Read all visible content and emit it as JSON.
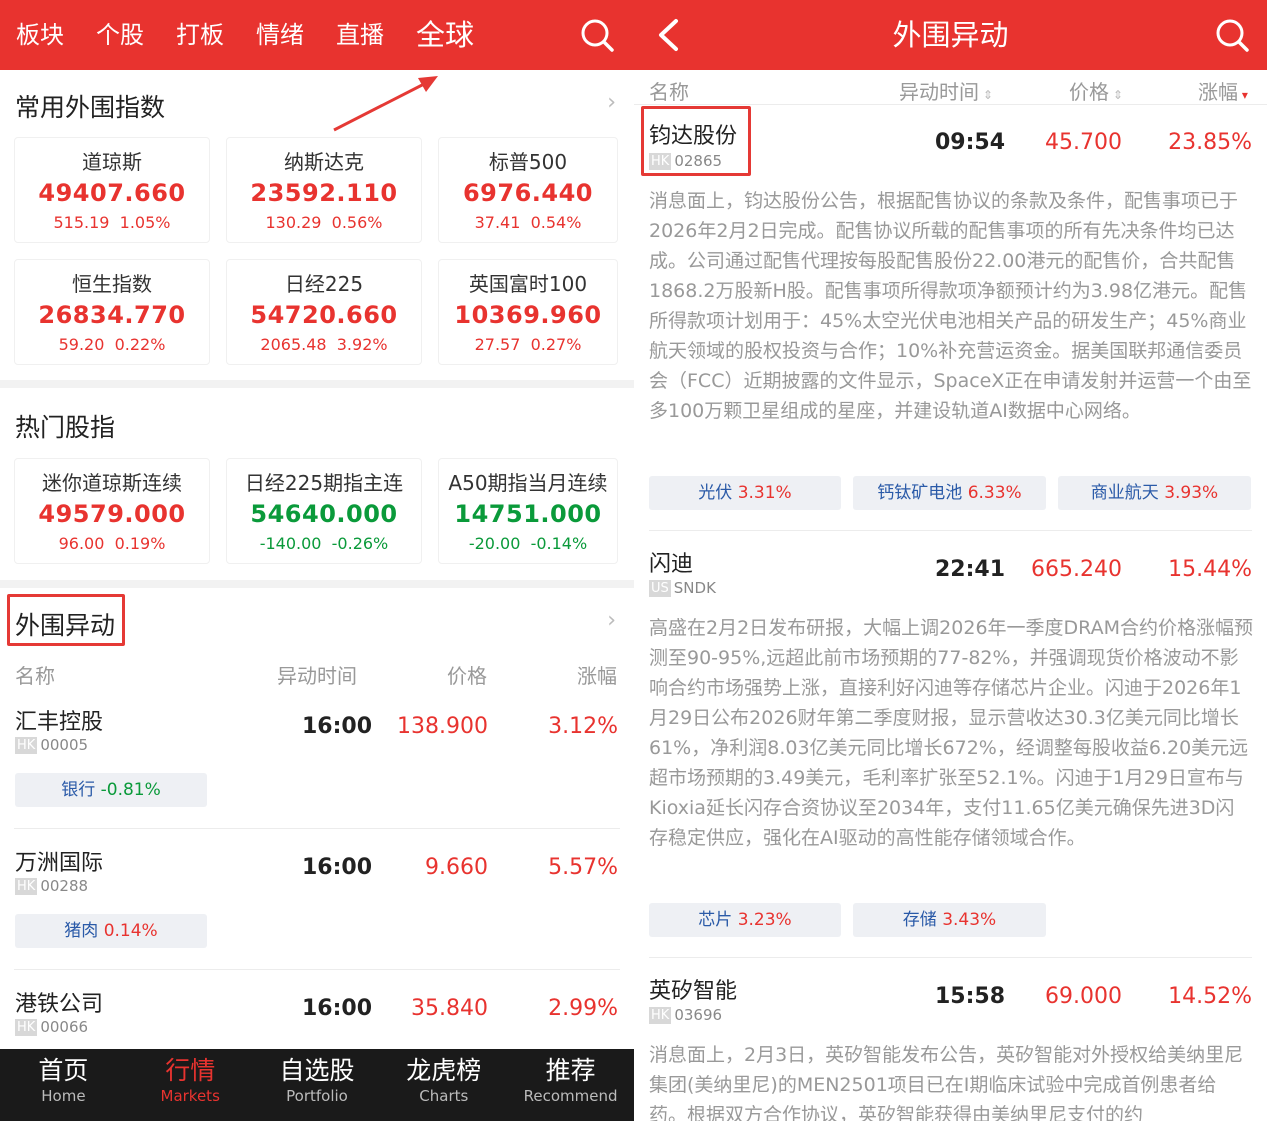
{
  "left": {
    "tabs": [
      "板块",
      "个股",
      "打板",
      "情绪",
      "直播",
      "全球"
    ],
    "active_tab": "全球",
    "common_title": "常用外围指数",
    "common": [
      {
        "name": "道琼斯",
        "price": "49407.660",
        "change": "515.19",
        "pct": "1.05%"
      },
      {
        "name": "纳斯达克",
        "price": "23592.110",
        "change": "130.29",
        "pct": "0.56%"
      },
      {
        "name": "标普500",
        "price": "6976.440",
        "change": "37.41",
        "pct": "0.54%"
      },
      {
        "name": "恒生指数",
        "price": "26834.770",
        "change": "59.20",
        "pct": "0.22%"
      },
      {
        "name": "日经225",
        "price": "54720.660",
        "change": "2065.48",
        "pct": "3.92%"
      },
      {
        "name": "英国富时100",
        "price": "10369.960",
        "change": "27.57",
        "pct": "0.27%"
      }
    ],
    "hot_title": "热门股指",
    "hot": [
      {
        "name": "迷你道琼斯连续",
        "price": "49579.000",
        "change": "96.00",
        "pct": "0.19%",
        "dir": "up"
      },
      {
        "name": "日经225期指主连",
        "price": "54640.000",
        "change": "-140.00",
        "pct": "-0.26%",
        "dir": "down"
      },
      {
        "name": "A50期指当月连续",
        "price": "14751.000",
        "change": "-20.00",
        "pct": "-0.14%",
        "dir": "down"
      }
    ],
    "move_title": "外围异动",
    "headers": {
      "name": "名称",
      "time": "异动时间",
      "price": "价格",
      "pct": "涨幅"
    },
    "rows": [
      {
        "name": "汇丰控股",
        "market": "HK",
        "code": "00005",
        "time": "16:00",
        "price": "138.900",
        "pct": "3.12%",
        "tag_name": "银行",
        "tag_val": "-0.81%",
        "tag_dir": "down"
      },
      {
        "name": "万洲国际",
        "market": "HK",
        "code": "00288",
        "time": "16:00",
        "price": "9.660",
        "pct": "5.57%",
        "tag_name": "猪肉",
        "tag_val": "0.14%",
        "tag_dir": "up"
      },
      {
        "name": "港铁公司",
        "market": "HK",
        "code": "00066",
        "time": "16:00",
        "price": "35.840",
        "pct": "2.99%"
      }
    ],
    "nav": [
      {
        "zh": "首页",
        "en": "Home"
      },
      {
        "zh": "行情",
        "en": "Markets"
      },
      {
        "zh": "自选股",
        "en": "Portfolio"
      },
      {
        "zh": "龙虎榜",
        "en": "Charts"
      },
      {
        "zh": "推荐",
        "en": "Recommend"
      }
    ]
  },
  "right": {
    "title": "外围异动",
    "headers": {
      "name": "名称",
      "time": "异动时间",
      "price": "价格",
      "pct": "涨幅"
    },
    "items": [
      {
        "name": "钧达股份",
        "market": "HK",
        "code": "02865",
        "time": "09:54",
        "price": "45.700",
        "pct": "23.85%",
        "news": "消息面上，钧达股份公告，根据配售协议的条款及条件，配售事项已于2026年2月2日完成。配售协议所载的配售事项的所有先决条件均已达成。公司通过配售代理按每股配售股份22.00港元的配售价，合共配售1868.2万股新H股。配售事项所得款项净额预计约为3.98亿港元。配售所得款项计划用于：45%太空光伏电池相关产品的研发生产；45%商业航天领域的股权投资与合作；10%补充营运资金。据美国联邦通信委员会（FCC）近期披露的文件显示，SpaceX正在申请发射并运营一个由至多100万颗卫星组成的星座，并建设轨道AI数据中心网络。",
        "tags": [
          {
            "name": "光伏",
            "val": "3.31%"
          },
          {
            "name": "钙钛矿电池",
            "val": "6.33%"
          },
          {
            "name": "商业航天",
            "val": "3.93%"
          }
        ]
      },
      {
        "name": "闪迪",
        "market": "US",
        "code": "SNDK",
        "time": "22:41",
        "price": "665.240",
        "pct": "15.44%",
        "news": "高盛在2月2日发布研报，大幅上调2026年一季度DRAM合约价格涨幅预测至90-95%,远超此前市场预期的77-82%，并强调现货价格波动不影响合约市场强势上涨，直接利好闪迪等存储芯片企业。闪迪于2026年1月29日公布2026财年第二季度财报，显示营收达30.3亿美元同比增长61%，净利润8.03亿美元同比增长672%，经调整每股收益6.20美元远超市场预期的3.49美元，毛利率扩张至52.1%。闪迪于1月29日宣布与Kioxia延长闪存合资协议至2034年，支付11.65亿美元确保先进3D闪存稳定供应，强化在AI驱动的高性能存储领域合作。",
        "tags": [
          {
            "name": "芯片",
            "val": "3.23%"
          },
          {
            "name": "存储",
            "val": "3.43%"
          }
        ]
      },
      {
        "name": "英矽智能",
        "market": "HK",
        "code": "03696",
        "time": "15:58",
        "price": "69.000",
        "pct": "14.52%",
        "news": "消息面上，2月3日，英矽智能发布公告，英矽智能对外授权给美纳里尼集团(美纳里尼)的MEN2501项目已在I期临床试验中完成首例患者给药。根据双方合作协议，英矽智能获得由美纳里尼支付的约"
      }
    ]
  },
  "colors": {
    "brand_red": "#e8332f",
    "up": "#e8332f",
    "down": "#0a9a3a",
    "tag_text": "#2a5aa8"
  }
}
